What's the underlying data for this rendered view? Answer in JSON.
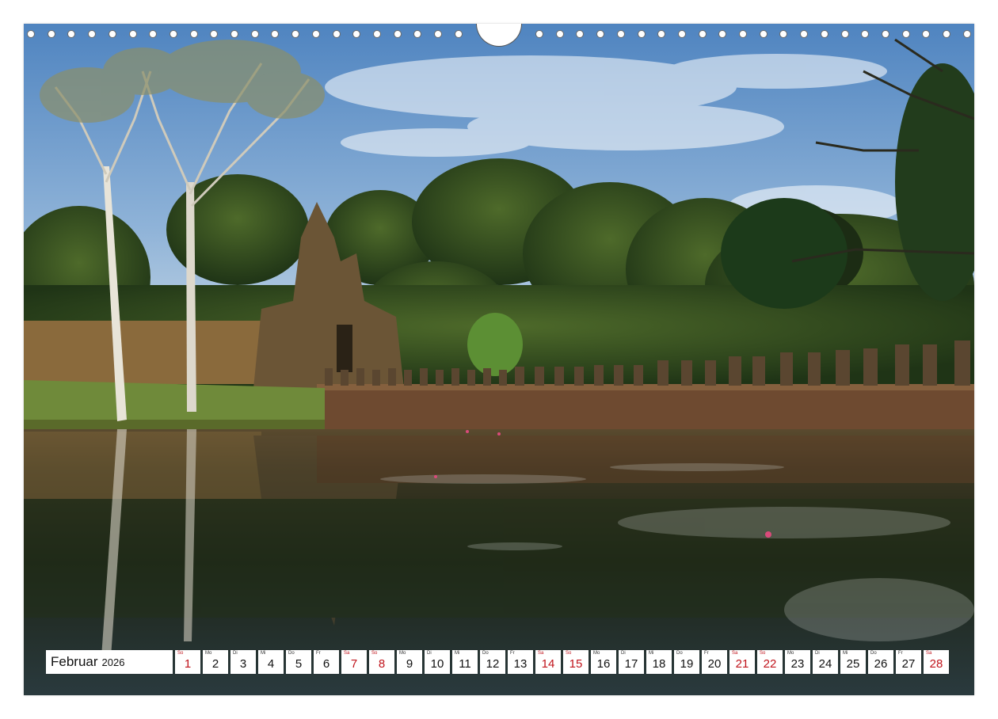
{
  "calendar": {
    "month": "Februar",
    "year": "2026",
    "days": [
      {
        "dow": "So",
        "num": "1",
        "weekend": true
      },
      {
        "dow": "Mo",
        "num": "2",
        "weekend": false
      },
      {
        "dow": "Di",
        "num": "3",
        "weekend": false
      },
      {
        "dow": "Mi",
        "num": "4",
        "weekend": false
      },
      {
        "dow": "Do",
        "num": "5",
        "weekend": false
      },
      {
        "dow": "Fr",
        "num": "6",
        "weekend": false
      },
      {
        "dow": "Sa",
        "num": "7",
        "weekend": true
      },
      {
        "dow": "So",
        "num": "8",
        "weekend": true
      },
      {
        "dow": "Mo",
        "num": "9",
        "weekend": false
      },
      {
        "dow": "Di",
        "num": "10",
        "weekend": false
      },
      {
        "dow": "Mi",
        "num": "11",
        "weekend": false
      },
      {
        "dow": "Do",
        "num": "12",
        "weekend": false
      },
      {
        "dow": "Fr",
        "num": "13",
        "weekend": false
      },
      {
        "dow": "Sa",
        "num": "14",
        "weekend": true
      },
      {
        "dow": "So",
        "num": "15",
        "weekend": true
      },
      {
        "dow": "Mo",
        "num": "16",
        "weekend": false
      },
      {
        "dow": "Di",
        "num": "17",
        "weekend": false
      },
      {
        "dow": "Mi",
        "num": "18",
        "weekend": false
      },
      {
        "dow": "Do",
        "num": "19",
        "weekend": false
      },
      {
        "dow": "Fr",
        "num": "20",
        "weekend": false
      },
      {
        "dow": "Sa",
        "num": "21",
        "weekend": true
      },
      {
        "dow": "So",
        "num": "22",
        "weekend": true
      },
      {
        "dow": "Mo",
        "num": "23",
        "weekend": false
      },
      {
        "dow": "Di",
        "num": "24",
        "weekend": false
      },
      {
        "dow": "Mi",
        "num": "25",
        "weekend": false
      },
      {
        "dow": "Do",
        "num": "26",
        "weekend": false
      },
      {
        "dow": "Fr",
        "num": "27",
        "weekend": false
      },
      {
        "dow": "Sa",
        "num": "28",
        "weekend": true
      }
    ]
  },
  "colors": {
    "weekend": "#c0131b",
    "sky": "#5f8fc6",
    "water": "#1e2418"
  }
}
